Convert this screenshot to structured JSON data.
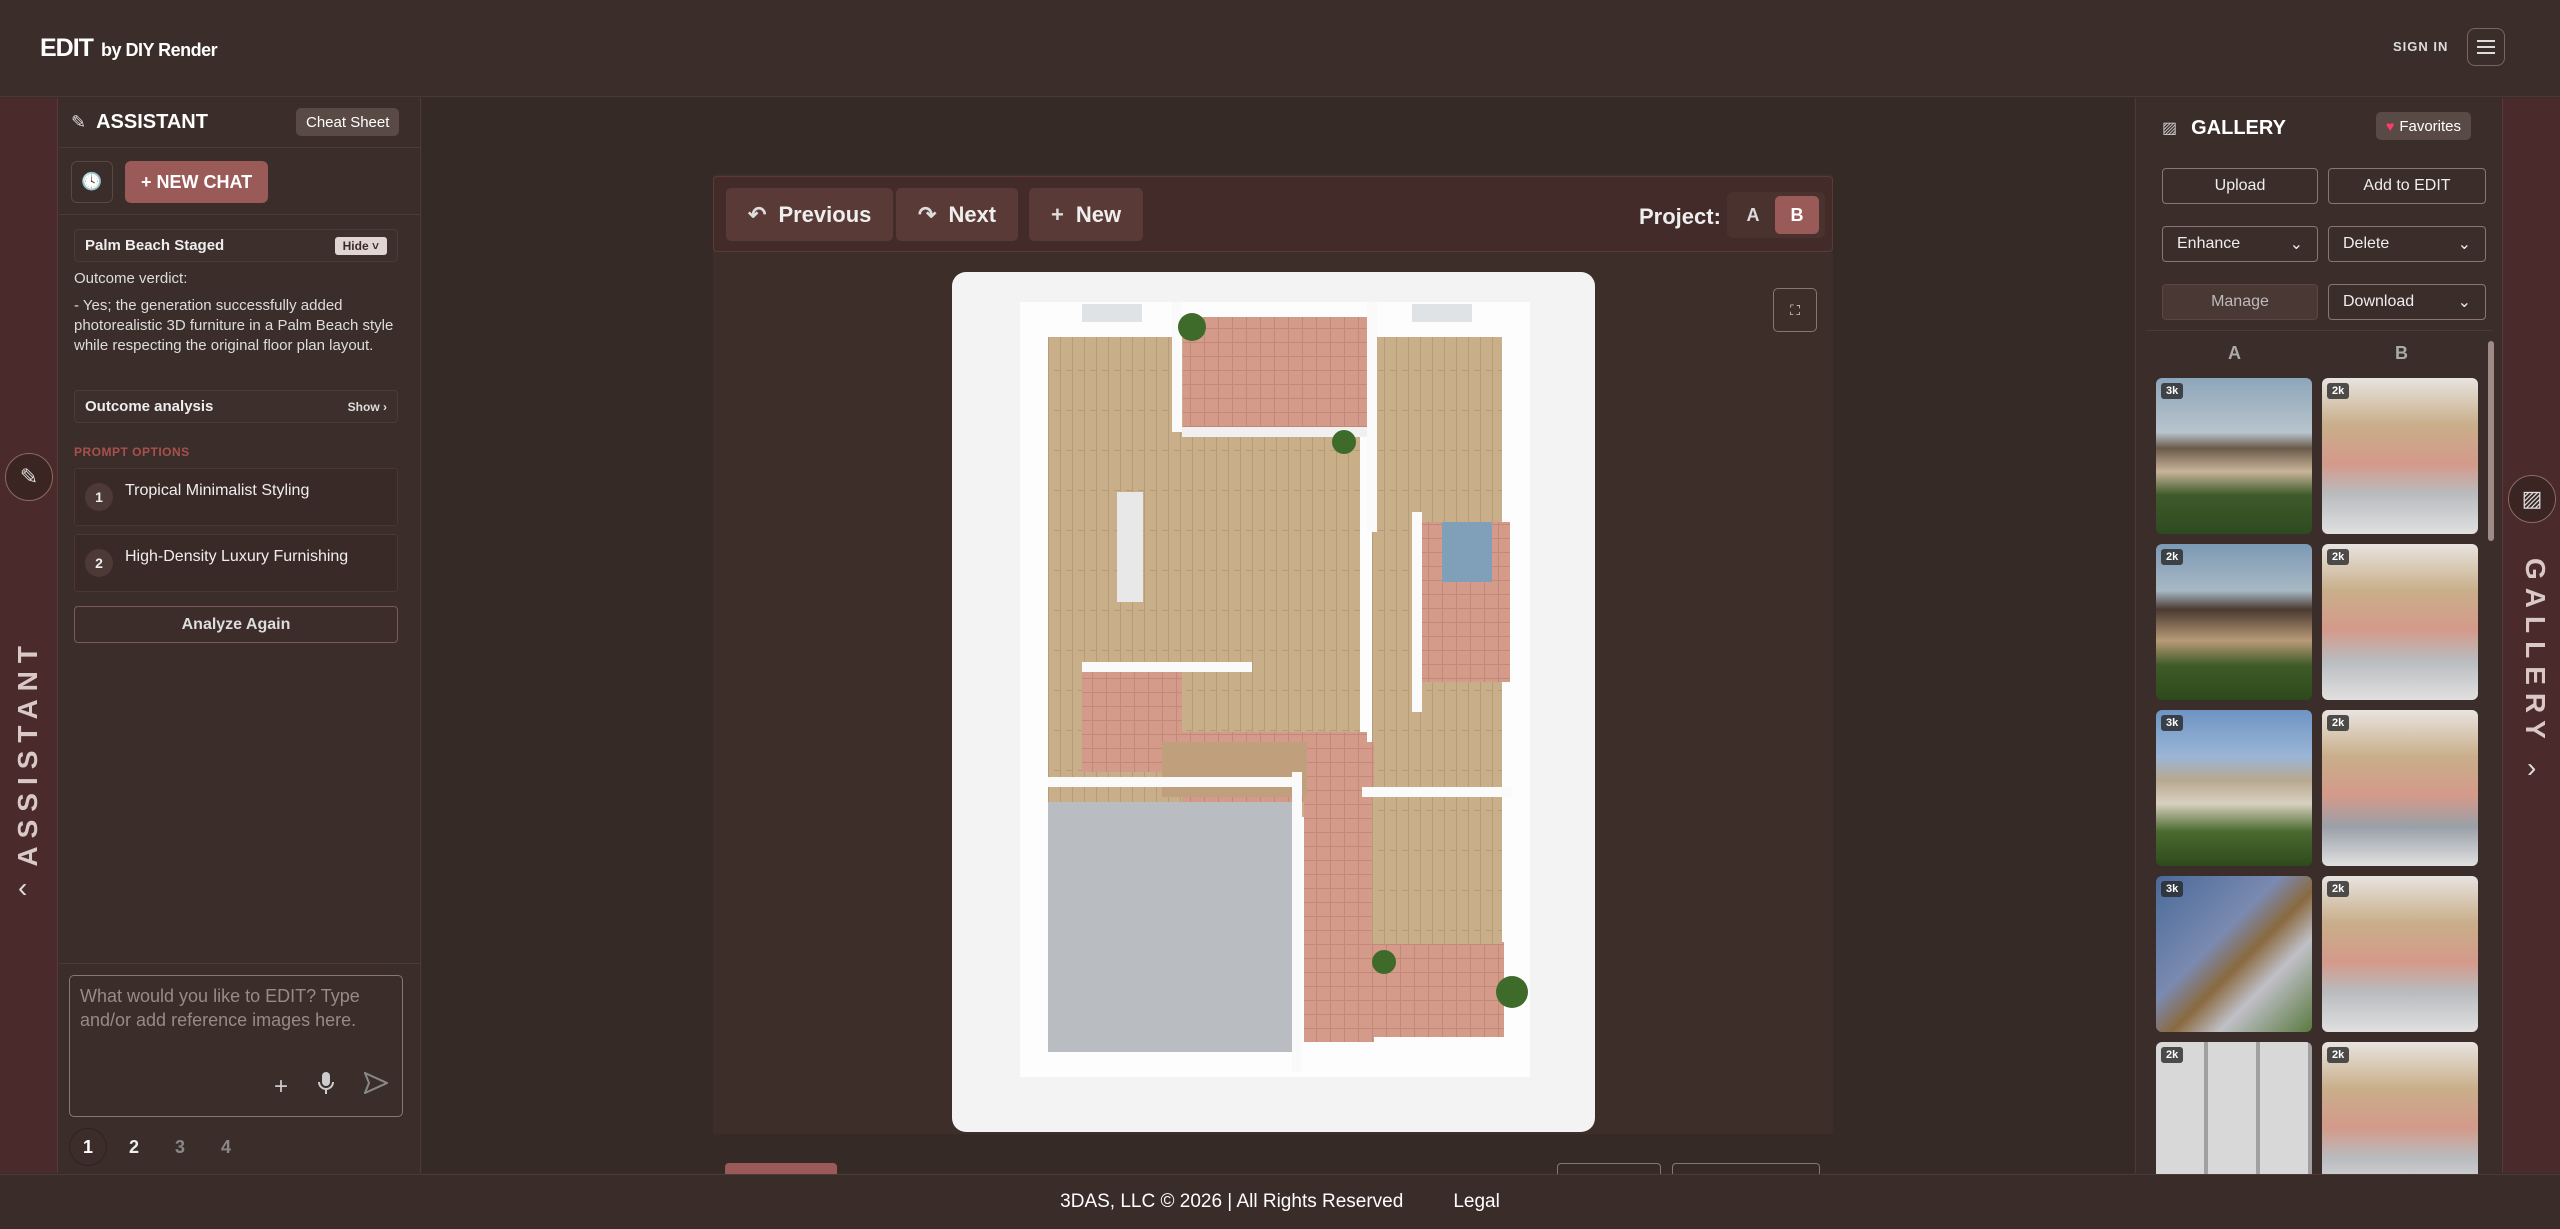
{
  "header": {
    "logo_main": "EDIT",
    "logo_sub": "by DIY Render",
    "signin": "SIGN IN"
  },
  "rails": {
    "left_label": "ASSISTANT",
    "right_label": "GALLERY"
  },
  "assistant": {
    "title": "ASSISTANT",
    "cheat_sheet": "Cheat Sheet",
    "new_chat": "+ NEW CHAT",
    "session_title": "Palm Beach Staged",
    "hide_label": "Hide ˅",
    "verdict_heading": "Outcome verdict:",
    "verdict_text": "- Yes; the generation successfully added photorealistic 3D furniture in a Palm Beach style while respecting the original floor plan layout.",
    "analysis_label": "Outcome analysis",
    "show_label": "Show ›",
    "prompt_options_heading": "PROMPT OPTIONS",
    "options": [
      {
        "num": "1",
        "label": "Tropical Minimalist Styling"
      },
      {
        "num": "2",
        "label": "High-Density Luxury Furnishing"
      }
    ],
    "analyze_again": "Analyze Again",
    "input_placeholder": "What would you like to EDIT? Type and/or add reference images here.",
    "pages": [
      "1",
      "2",
      "3",
      "4"
    ],
    "active_page": "1"
  },
  "toolbar": {
    "previous": "Previous",
    "next": "Next",
    "new": "New",
    "project_label": "Project:",
    "project_a": "A",
    "project_b": "B",
    "project_selected": "B"
  },
  "gallery": {
    "title": "GALLERY",
    "favorites": "Favorites",
    "upload": "Upload",
    "add_to_edit": "Add to EDIT",
    "enhance": "Enhance",
    "delete": "Delete",
    "manage": "Manage",
    "download": "Download",
    "col_a": "A",
    "col_b": "B",
    "col_a_badges": [
      "3k",
      "2k",
      "3k",
      "3k",
      "2k"
    ],
    "col_b_badges": [
      "2k",
      "2k",
      "2k",
      "2k",
      "2k"
    ]
  },
  "footer": {
    "copyright": "3DAS, LLC © 2026 | All Rights Reserved",
    "legal": "Legal"
  },
  "colors": {
    "accent": "#9a5a58",
    "background": "#3a2d29",
    "rail": "#4a2a2a"
  }
}
